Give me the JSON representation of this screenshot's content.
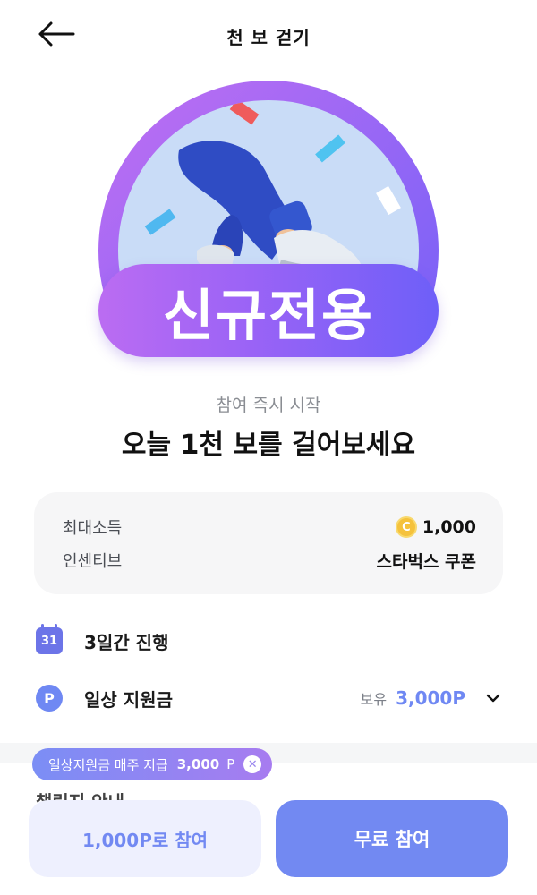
{
  "header": {
    "title": "천 보 걷기",
    "back_icon": "arrow-left-icon"
  },
  "hero": {
    "badge_text": "신규전용"
  },
  "intro": {
    "subtitle": "참여 즉시 시작",
    "title": "오늘 1천 보를 걸어보세요"
  },
  "info_card": {
    "rows": [
      {
        "label": "최대소득",
        "value": "1,000",
        "icon": "coin-icon",
        "icon_glyph": "C"
      },
      {
        "label": "인센티브",
        "value": "스타벅스 쿠폰"
      }
    ]
  },
  "features": [
    {
      "icon": "calendar-icon",
      "icon_text": "31",
      "label": "3일간 진행"
    },
    {
      "icon": "point-icon",
      "icon_text": "P",
      "label": "일상 지원금",
      "hold_label": "보유",
      "hold_value": "3,000P"
    }
  ],
  "toast": {
    "text": "일상지원금 매주 지급",
    "amount": "3,000",
    "unit": "P",
    "close_glyph": "✕"
  },
  "hidden_section": {
    "heading": "챌린지 안내"
  },
  "buttons": {
    "paid": "1,000P로 참여",
    "free": "무료 참여"
  },
  "colors": {
    "accent": "#7289f2",
    "purple": "#9a63f6",
    "coin": "#f5c23c"
  }
}
